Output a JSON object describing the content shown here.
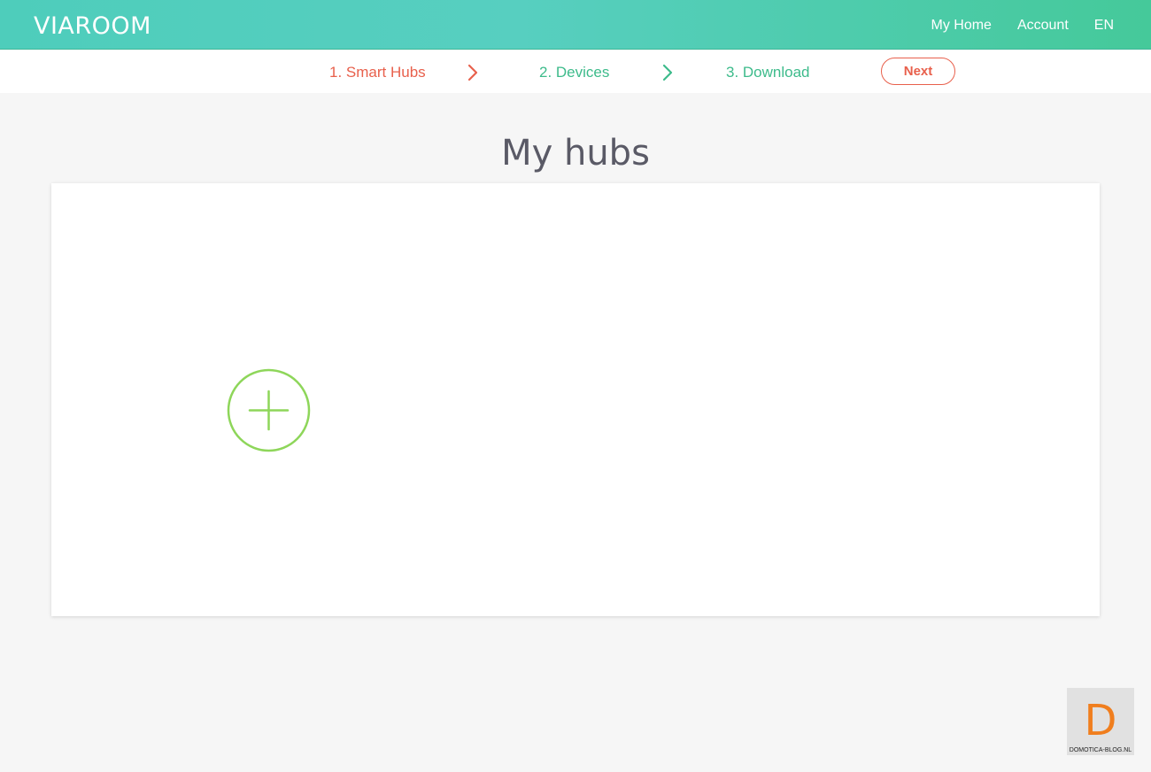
{
  "header": {
    "logo": "VIAROOM",
    "nav": {
      "home": "My Home",
      "account": "Account",
      "language": "EN"
    }
  },
  "steps": {
    "items": [
      {
        "label": "1. Smart Hubs",
        "state": "active"
      },
      {
        "label": "2. Devices",
        "state": "pending"
      },
      {
        "label": "3. Download",
        "state": "pending"
      }
    ],
    "next_label": "Next"
  },
  "main": {
    "title": "My hubs",
    "add_icon": "plus-circle-icon"
  },
  "watermark": {
    "letter": "D",
    "text": "DOMOTICA-BLOG.NL"
  },
  "colors": {
    "accent_teal": "#4ecdbb",
    "accent_green": "#45c99a",
    "active_step": "#e8604c",
    "pending_step": "#3dbb8b",
    "add_icon": "#8ed65a",
    "watermark_letter": "#f07e1e"
  }
}
